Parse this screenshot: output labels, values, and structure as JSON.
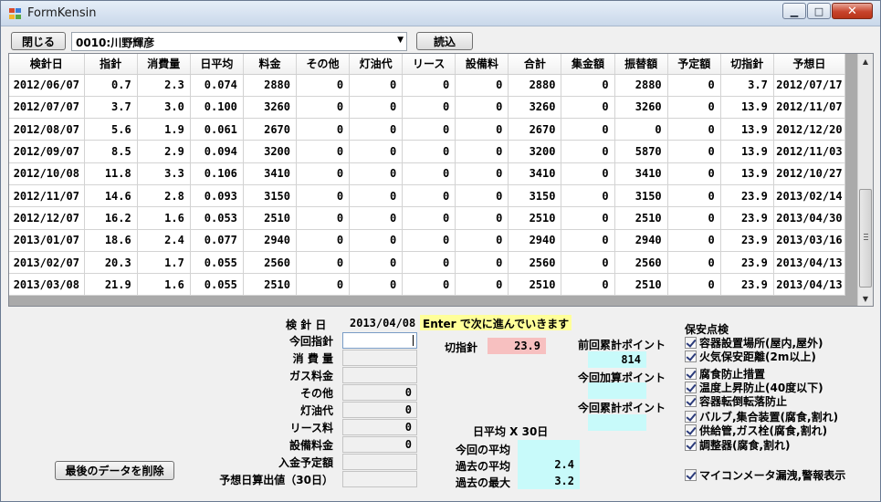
{
  "window": {
    "title": "FormKensin",
    "min_glyph": "▁",
    "max_glyph": "□",
    "close_glyph": "✕"
  },
  "toolbar": {
    "close_label": "閉じる",
    "customer_value": "0010:川野輝彦",
    "load_label": "読込"
  },
  "grid": {
    "columns": [
      "検針日",
      "指針",
      "消費量",
      "日平均",
      "料金",
      "その他",
      "灯油代",
      "リース",
      "設備料",
      "合計",
      "集金額",
      "振替額",
      "予定額",
      "切指針",
      "予想日"
    ],
    "rows": [
      [
        "2012/06/07",
        "0.7",
        "2.3",
        "0.074",
        "2880",
        "0",
        "0",
        "0",
        "0",
        "2880",
        "0",
        "2880",
        "0",
        "3.7",
        "2012/07/17"
      ],
      [
        "2012/07/07",
        "3.7",
        "3.0",
        "0.100",
        "3260",
        "0",
        "0",
        "0",
        "0",
        "3260",
        "0",
        "3260",
        "0",
        "13.9",
        "2012/11/07"
      ],
      [
        "2012/08/07",
        "5.6",
        "1.9",
        "0.061",
        "2670",
        "0",
        "0",
        "0",
        "0",
        "2670",
        "0",
        "0",
        "0",
        "13.9",
        "2012/12/20"
      ],
      [
        "2012/09/07",
        "8.5",
        "2.9",
        "0.094",
        "3200",
        "0",
        "0",
        "0",
        "0",
        "3200",
        "0",
        "5870",
        "0",
        "13.9",
        "2012/11/03"
      ],
      [
        "2012/10/08",
        "11.8",
        "3.3",
        "0.106",
        "3410",
        "0",
        "0",
        "0",
        "0",
        "3410",
        "0",
        "3410",
        "0",
        "13.9",
        "2012/10/27"
      ],
      [
        "2012/11/07",
        "14.6",
        "2.8",
        "0.093",
        "3150",
        "0",
        "0",
        "0",
        "0",
        "3150",
        "0",
        "3150",
        "0",
        "23.9",
        "2013/02/14"
      ],
      [
        "2012/12/07",
        "16.2",
        "1.6",
        "0.053",
        "2510",
        "0",
        "0",
        "0",
        "0",
        "2510",
        "0",
        "2510",
        "0",
        "23.9",
        "2013/04/30"
      ],
      [
        "2013/01/07",
        "18.6",
        "2.4",
        "0.077",
        "2940",
        "0",
        "0",
        "0",
        "0",
        "2940",
        "0",
        "2940",
        "0",
        "23.9",
        "2013/03/16"
      ],
      [
        "2013/02/07",
        "20.3",
        "1.7",
        "0.055",
        "2560",
        "0",
        "0",
        "0",
        "0",
        "2560",
        "0",
        "2560",
        "0",
        "23.9",
        "2013/04/13"
      ],
      [
        "2013/03/08",
        "21.9",
        "1.6",
        "0.055",
        "2510",
        "0",
        "0",
        "0",
        "0",
        "2510",
        "0",
        "2510",
        "0",
        "23.9",
        "2013/04/13"
      ]
    ]
  },
  "scrollbar": {
    "up_glyph": "▲",
    "down_glyph": "▼"
  },
  "form": {
    "kenshin_date_label": "検 針 日",
    "kenshin_date_value": "2013/04/08",
    "hint": "Enter で次に進んでいきます",
    "prev_reading_label": "今回指針",
    "prev_reading_value": "",
    "consumption_label": "消 費 量",
    "consumption_value": "",
    "gas_fee_label": "ガス料金",
    "gas_fee_value": "",
    "other_label": "その他",
    "other_value": "0",
    "kerosene_label": "灯油代",
    "kerosene_value": "0",
    "lease_label": "リース料",
    "lease_value": "0",
    "equipment_label": "設備料金",
    "equipment_value": "0",
    "deposit_label": "入金予定額",
    "deposit_value": "",
    "forecast_label": "予想日算出値（30日）",
    "forecast_value": "",
    "cut_reading_label": "切指針",
    "cut_reading_value": "23.9",
    "prev_points_label": "前回累計ポイント",
    "prev_points_value": "814",
    "add_points_label": "今回加算ポイント",
    "add_points_value": "",
    "total_points_label": "今回累計ポイント",
    "total_points_value": "",
    "daily_avg_header": "日平均 X 30日",
    "current_avg_label": "今回の平均",
    "current_avg_value": "",
    "past_avg_label": "過去の平均",
    "past_avg_value": "2.4",
    "past_max_label": "過去の最大",
    "past_max_value": "3.2",
    "delete_label": "最後のデータを削除"
  },
  "safety": {
    "title": "保安点検",
    "items": [
      "容器設置場所(屋内,屋外)",
      "火気保安距離(2m以上)",
      "腐食防止措置",
      "温度上昇防止(40度以下)",
      "容器転倒転落防止",
      "バルブ,集合装置(腐食,割れ)",
      "供給管,ガス栓(腐食,割れ)",
      "調整器(腐食,割れ)",
      "マイコンメータ漏洩,警報表示"
    ]
  }
}
